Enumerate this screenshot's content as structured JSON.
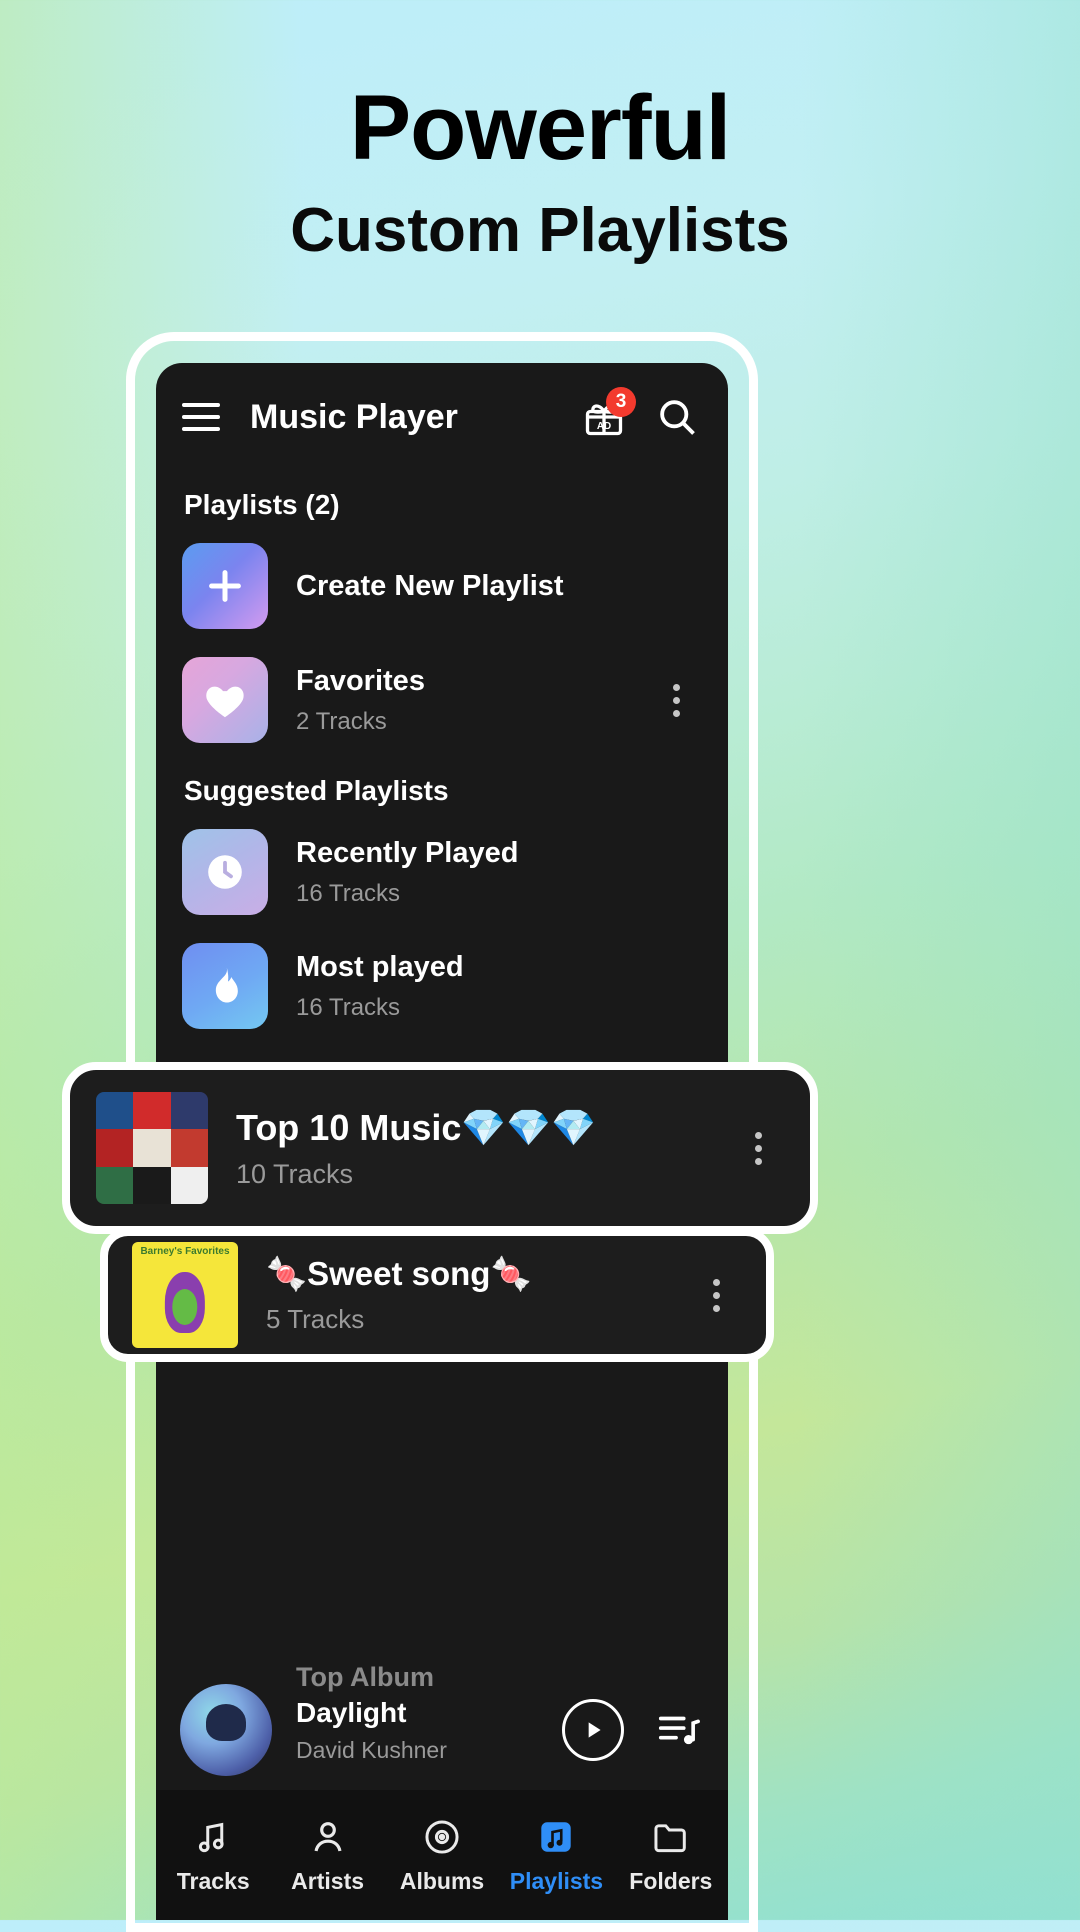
{
  "promo": {
    "headline": "Powerful",
    "subheadline": "Custom Playlists"
  },
  "colors": {
    "accent": "#2f8ef7",
    "badge": "#f33a2e",
    "screen_bg": "#191919",
    "nav_bg": "#111111"
  },
  "appbar": {
    "menu_icon": "hamburger-icon",
    "title": "Music Player",
    "gift_icon": "gift-ad-icon",
    "gift_badge": "3",
    "search_icon": "search-icon"
  },
  "sections": {
    "playlists_header": "Playlists (2)",
    "suggested_header": "Suggested Playlists"
  },
  "playlists": [
    {
      "title": "Create New Playlist",
      "subtitle": "",
      "icon": "plus-icon",
      "has_menu": false
    },
    {
      "title": "Favorites",
      "subtitle": "2 Tracks",
      "icon": "heart-icon",
      "has_menu": true
    }
  ],
  "suggested": [
    {
      "title": "Recently Played",
      "subtitle": "16 Tracks",
      "icon": "clock-icon"
    },
    {
      "title": "Most played",
      "subtitle": "16 Tracks",
      "icon": "flame-icon"
    }
  ],
  "highlight_cards": [
    {
      "title": "Top 10 Music💎💎💎",
      "subtitle": "10 Tracks",
      "thumb": "album-collage-art",
      "menu_icon": "more-vertical-icon"
    },
    {
      "title": "🍬Sweet song🍬",
      "subtitle": "5 Tracks",
      "thumb": "barney-favorites-art",
      "menu_icon": "more-vertical-icon"
    }
  ],
  "miniplayer": {
    "label": "Top Album",
    "title": "Daylight",
    "artist": "David Kushner",
    "play_icon": "play-circle-icon",
    "queue_icon": "queue-music-icon",
    "art": "daylight-album-art"
  },
  "bottomnav": {
    "items": [
      {
        "label": "Tracks",
        "icon": "music-note-icon",
        "active": false
      },
      {
        "label": "Artists",
        "icon": "person-icon",
        "active": false
      },
      {
        "label": "Albums",
        "icon": "disc-icon",
        "active": false
      },
      {
        "label": "Playlists",
        "icon": "playlist-icon",
        "active": true
      },
      {
        "label": "Folders",
        "icon": "folder-icon",
        "active": false
      }
    ]
  }
}
